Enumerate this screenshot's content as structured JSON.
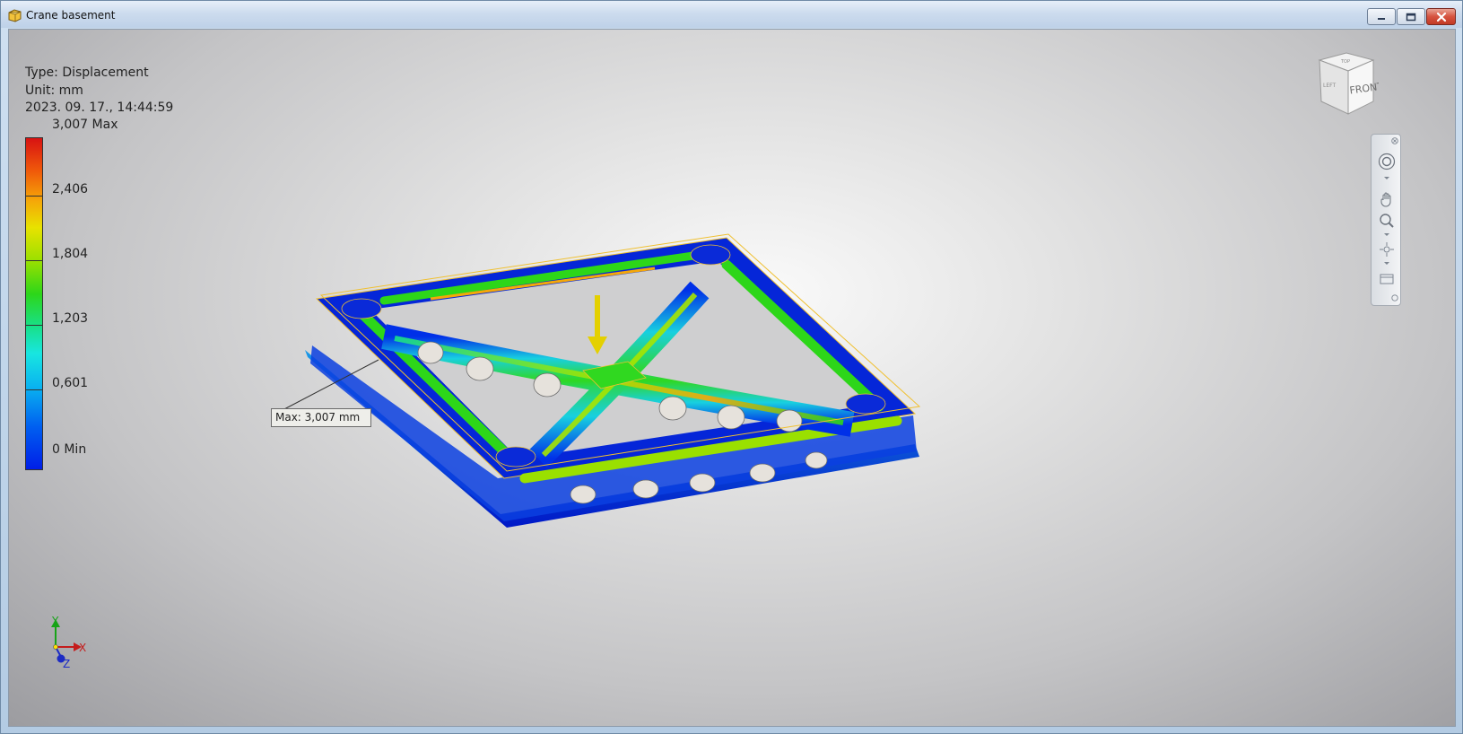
{
  "window": {
    "title": "Crane basement",
    "icons": {
      "app": "part-cube-icon",
      "minimize": "minimize-icon",
      "maximize": "maximize-icon",
      "close": "close-icon"
    }
  },
  "legend": {
    "type_line": "Type: Displacement",
    "unit_line": "Unit: mm",
    "timestamp": "2023. 09. 17., 14:44:59",
    "scale": {
      "max": "3,007 Max",
      "labels": [
        "2,406",
        "1,804",
        "1,203",
        "0,601"
      ],
      "min": "0 Min"
    }
  },
  "probe": {
    "max_label": "Max: 3,007 mm"
  },
  "viewcube": {
    "face_front": "FRONT",
    "face_left": "LEFT",
    "face_top": "TOP"
  },
  "triad": {
    "x": "X",
    "y": "Y",
    "z": "Z"
  },
  "navigation_bar": {
    "tools": [
      "steering-wheel-icon",
      "pan-icon",
      "zoom-icon",
      "orbit-icon",
      "look-at-icon"
    ]
  },
  "colors": {
    "max": "#d81212",
    "orange": "#f5a808",
    "yellow": "#e8e200",
    "green": "#2dd619",
    "cyan": "#18e6e0",
    "min": "#001ee8",
    "load_arrow": "#e4d000",
    "outline": "#f0c030"
  }
}
